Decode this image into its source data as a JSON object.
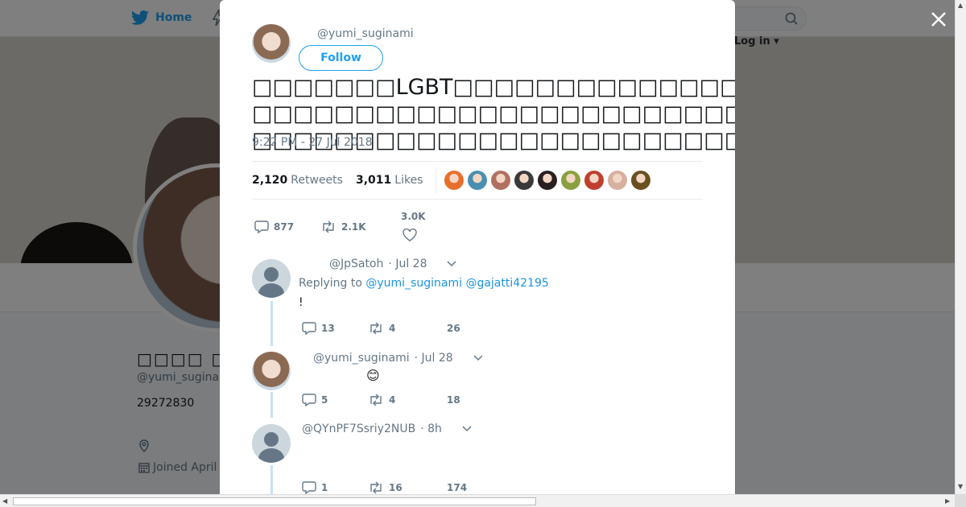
{
  "nav": {
    "home_label": "Home",
    "login_label": "Log in"
  },
  "background_profile": {
    "name": "□□□□ □□□□",
    "handle": "@yumi_sugina",
    "bio": "29272830",
    "joined": "Joined April"
  },
  "tweet": {
    "handle": "@yumi_suginami",
    "follow_label": "Follow",
    "text": "□□□□□□□LGBT□□□□□□□□□□□□□□□□□□□□□□□□□□□□□□□□□□□□□□□□□□□□□□□□□□□□□□□□□□□□□□□□□□□□□□□□□□□□□□□□□□□□□□□□□□□□□□□",
    "time": "9:22 PM - 27 Jul 2018",
    "retweets_count": "2,120",
    "retweets_label": "Retweets",
    "likes_count": "3,011",
    "likes_label": "Likes",
    "replies_action": "877",
    "retweets_action": "2.1K",
    "likes_action": "3.0K"
  },
  "likers": [
    "#e86f2b",
    "#4a8fb0",
    "#b07060",
    "#3a3a3a",
    "#2a2020",
    "#8aa040",
    "#c04030",
    "#d8b0a0",
    "#6a5020"
  ],
  "replies": [
    {
      "handle": "@JpSatoh",
      "date": "· Jul 28",
      "replying_label": "Replying to",
      "mentions": "@yumi_suginami @gajatti42195",
      "text": "!",
      "reply_count": "13",
      "retweet_count": "4",
      "like_count": "26"
    },
    {
      "handle": "@yumi_suginami",
      "date": "· Jul 28",
      "text": "😊",
      "reply_count": "5",
      "retweet_count": "4",
      "like_count": "18"
    },
    {
      "handle": "@QYnPF7Ssriy2NUB",
      "date": "· 8h",
      "text": "",
      "reply_count": "1",
      "retweet_count": "16",
      "like_count": "174"
    }
  ],
  "colors": {
    "brand": "#1da1f2",
    "mention": "#1b95e0",
    "thread": "#c4e4f7"
  }
}
